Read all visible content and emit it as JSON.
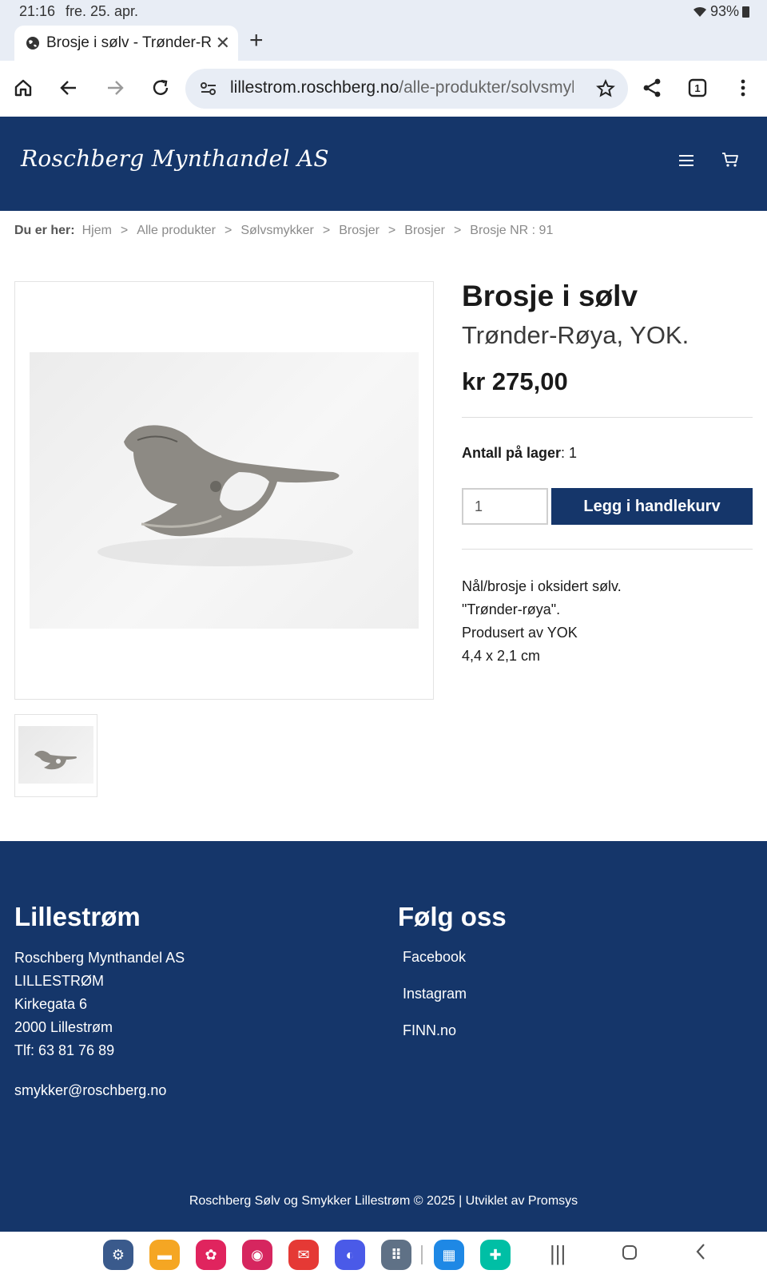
{
  "status": {
    "time": "21:16",
    "date": "fre. 25. apr.",
    "battery": "93%"
  },
  "browser": {
    "tab_title": "Brosje i sølv - Trønder-Røya, YOK.",
    "url_host": "lillestrom.roschberg.no",
    "url_path": "/alle-produkter/solvsmykker/brosjer",
    "tab_count": "1"
  },
  "site": {
    "logo": "Roschberg Mynthandel AS"
  },
  "breadcrumb": {
    "label": "Du er her:",
    "items": [
      "Hjem",
      "Alle produkter",
      "Sølvsmykker",
      "Brosjer",
      "Brosjer",
      "Brosje NR : 91"
    ],
    "separator": ">"
  },
  "product": {
    "title": "Brosje i sølv",
    "subtitle": "Trønder-Røya, YOK.",
    "price": "kr 275,00",
    "stock_label": "Antall på lager",
    "stock_value": ": 1",
    "quantity": "1",
    "add_to_cart": "Legg i handlekurv",
    "description": [
      "Nål/brosje i oksidert sølv.",
      "\"Trønder-røya\".",
      "Produsert av YOK",
      "4,4 x 2,1 cm"
    ]
  },
  "footer": {
    "left_heading": "Lillestrøm",
    "address_lines": [
      "Roschberg Mynthandel AS",
      "LILLESTRØM",
      "Kirkegata 6",
      "2000 Lillestrøm",
      "Tlf: 63 81 76 89"
    ],
    "email": "smykker@roschberg.no",
    "right_heading": "Følg oss",
    "social_links": [
      "Facebook",
      "Instagram",
      "FINN.no"
    ],
    "copyright": "Roschberg Sølv og Smykker Lillestrøm © 2025 | Utviklet av Promsys"
  },
  "colors": {
    "brand": "#15366a",
    "chrome": "#e8edf5"
  },
  "dock_apps": [
    "settings-icon",
    "files-icon",
    "gallery-icon",
    "camera-icon",
    "email-icon",
    "browser-icon",
    "apps-grid-icon",
    "bookshelf-icon",
    "fitness-icon"
  ]
}
